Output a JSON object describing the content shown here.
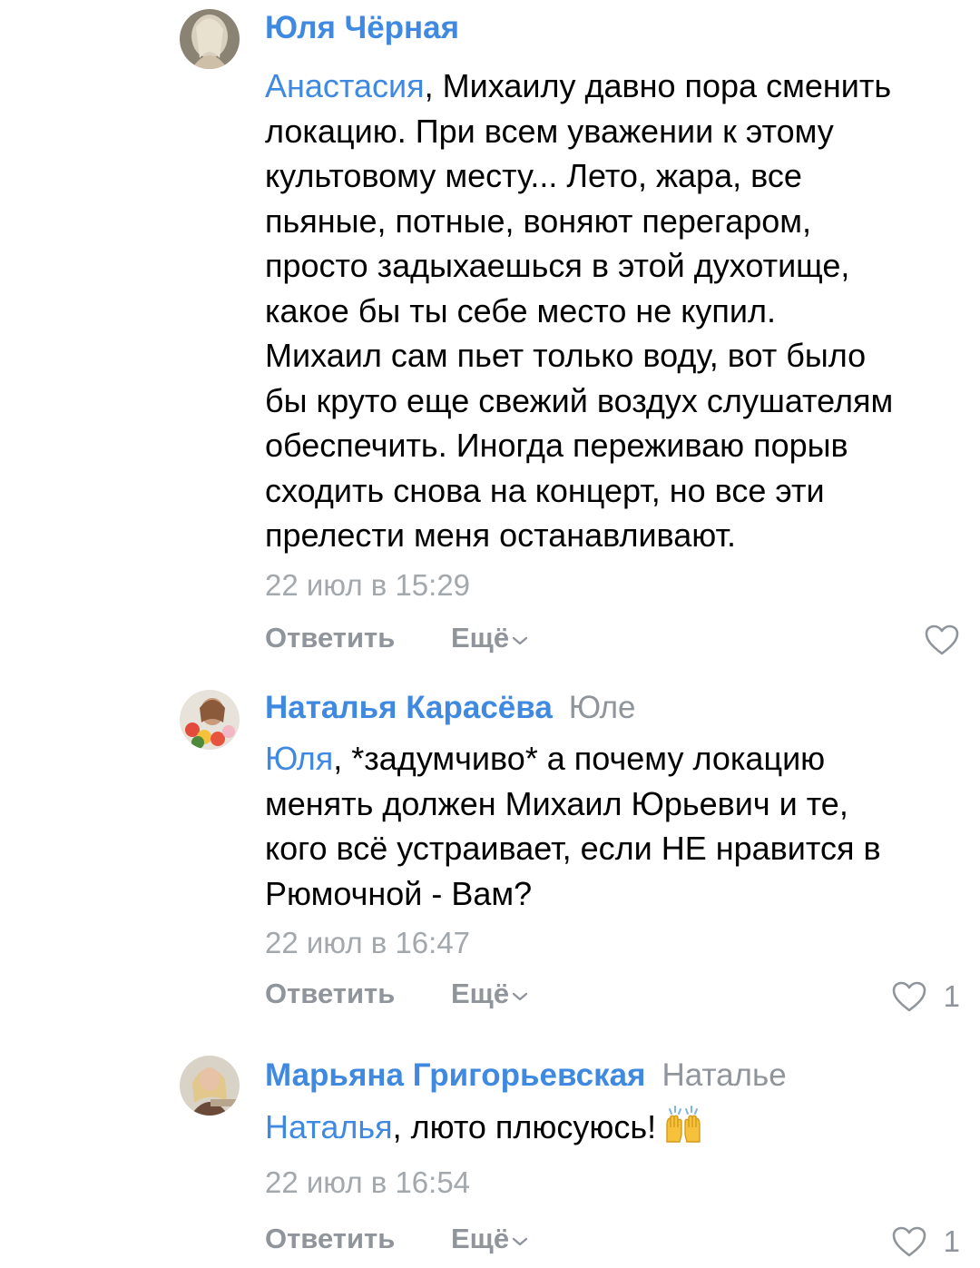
{
  "comments": [
    {
      "author": "Юля Чёрная",
      "reply_to": "",
      "mention": "Анастасия",
      "text": ", Михаилу давно пора сменить\nлокацию. При всем уважении к этому\nкультовому месту... Лето, жара, все\nпьяные, потные, воняют перегаром,\nпросто задыхаешься в этой духотище,\nкакое бы ты себе место не купил.\nМихаил сам пьет только воду, вот было\nбы круто еще свежий воздух слушателям\nобеспечить. Иногда переживаю порыв\nсходить снова на концерт, но все эти\nпрелести меня останавливают.",
      "date": "22 июл в 15:29",
      "reply_label": "Ответить",
      "more_label": "Ещё",
      "likes": ""
    },
    {
      "author": "Наталья Карасёва",
      "reply_to": "Юле",
      "mention": "Юля",
      "text": ", *задумчиво* а почему локацию\nменять должен Михаил Юрьевич и те,\nкого всё устраивает, если НЕ нравится в\nРюмочной - Вам?",
      "date": "22 июл в 16:47",
      "reply_label": "Ответить",
      "more_label": "Ещё",
      "likes": "1"
    },
    {
      "author": "Марьяна Григорьевская",
      "reply_to": "Наталье",
      "mention": "Наталья",
      "text": ", люто плюсуюсь!",
      "emoji": "raising-hands-emoji",
      "date": "22 июл в 16:54",
      "reply_label": "Ответить",
      "more_label": "Ещё",
      "likes": "1"
    }
  ],
  "colors": {
    "link": "#3f8ae0",
    "secondary": "#8f959b",
    "date": "#a3a8ad",
    "text": "#000000"
  }
}
